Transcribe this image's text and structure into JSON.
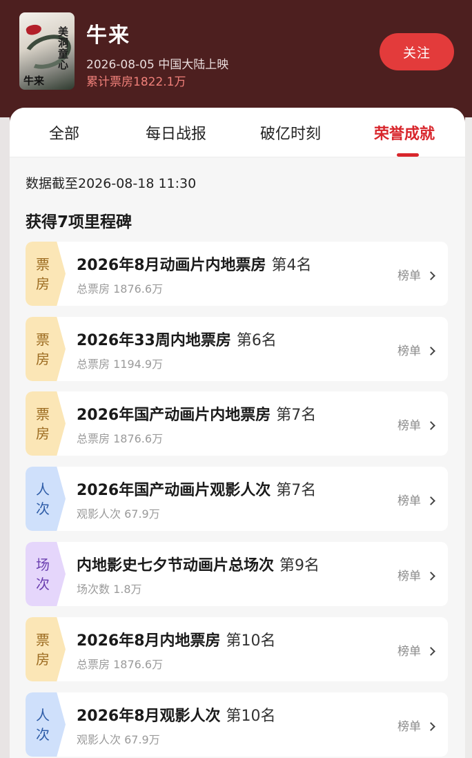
{
  "movie": {
    "poster_title": "美洞童心",
    "poster_name": "牛来",
    "title": "牛来",
    "release": "2026-08-05 中国大陆上映",
    "gross": "累计票房1822.1万",
    "follow_label": "关注"
  },
  "tabs": [
    {
      "label": "全部",
      "active": false
    },
    {
      "label": "每日战报",
      "active": false
    },
    {
      "label": "破亿时刻",
      "active": false
    },
    {
      "label": "荣誉成就",
      "active": true
    }
  ],
  "update_time": "数据截至2026-08-18  11:30",
  "section_title": "获得7项里程碑",
  "colors": {
    "accent": "#d8262c",
    "header_bg": "#4d1f1f",
    "box_tag": "#fbe6b6",
    "people_tag": "#cfe0fb",
    "shows_tag": "#e5d6fb"
  },
  "milestones": [
    {
      "tag_top": "票",
      "tag_bottom": "房",
      "kind": "box",
      "title": "2026年8月动画片内地票房",
      "rank": "第4名",
      "sub": "总票房 1876.6万",
      "link": "榜单"
    },
    {
      "tag_top": "票",
      "tag_bottom": "房",
      "kind": "box",
      "title": "2026年33周内地票房",
      "rank": "第6名",
      "sub": "总票房 1194.9万",
      "link": "榜单"
    },
    {
      "tag_top": "票",
      "tag_bottom": "房",
      "kind": "box",
      "title": "2026年国产动画片内地票房",
      "rank": "第7名",
      "sub": "总票房 1876.6万",
      "link": "榜单"
    },
    {
      "tag_top": "人",
      "tag_bottom": "次",
      "kind": "people",
      "title": "2026年国产动画片观影人次",
      "rank": "第7名",
      "sub": "观影人次 67.9万",
      "link": "榜单"
    },
    {
      "tag_top": "场",
      "tag_bottom": "次",
      "kind": "shows",
      "title": "内地影史七夕节动画片总场次",
      "rank": "第9名",
      "sub": "场次数 1.8万",
      "link": "榜单"
    },
    {
      "tag_top": "票",
      "tag_bottom": "房",
      "kind": "box",
      "title": "2026年8月内地票房",
      "rank": "第10名",
      "sub": "总票房 1876.6万",
      "link": "榜单"
    },
    {
      "tag_top": "人",
      "tag_bottom": "次",
      "kind": "people",
      "title": "2026年8月观影人次",
      "rank": "第10名",
      "sub": "观影人次 67.9万",
      "link": "榜单"
    }
  ]
}
